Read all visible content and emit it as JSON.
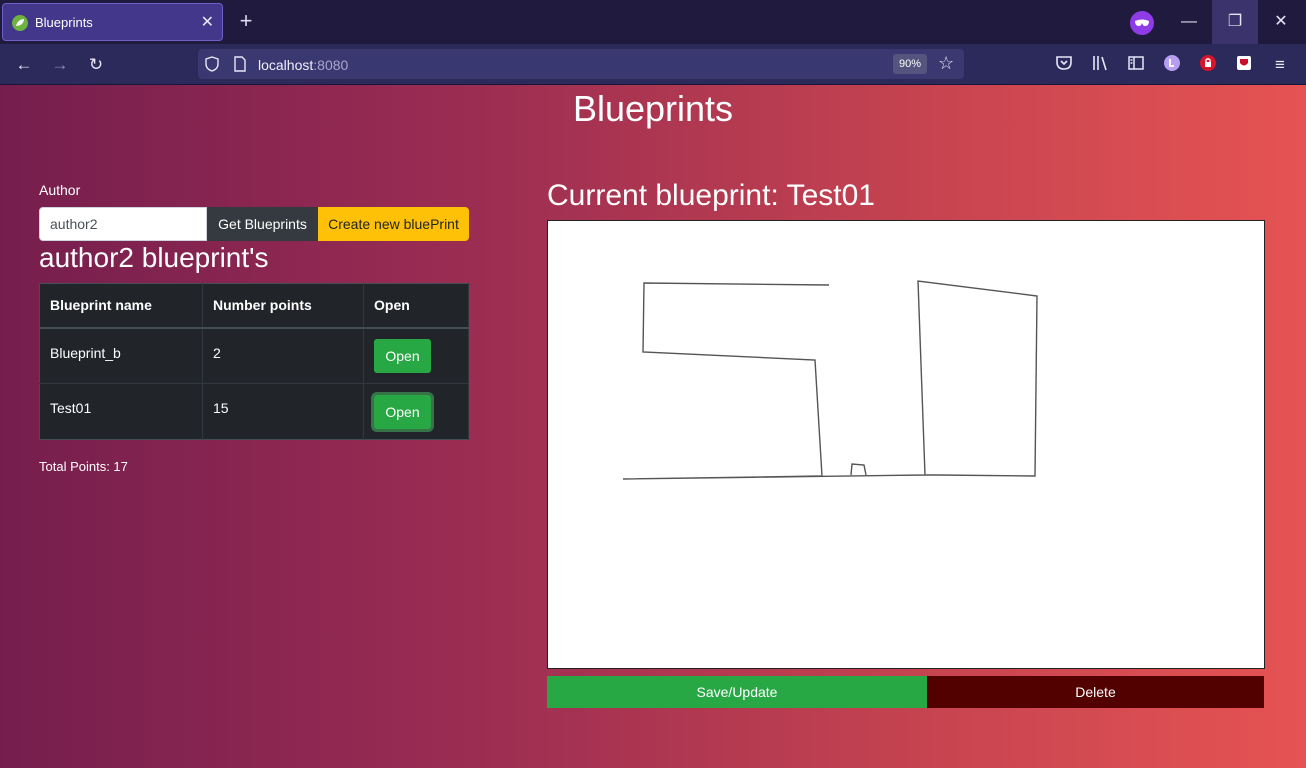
{
  "browser": {
    "tab_title": "Blueprints",
    "url_host": "localhost",
    "url_port": ":8080",
    "zoom": "90%"
  },
  "page": {
    "title": "Blueprints",
    "author_label": "Author",
    "author_value": "author2",
    "get_button": "Get Blueprints",
    "create_button": "Create new bluePrint",
    "list_heading": "author2 blueprint's",
    "table": {
      "headers": [
        "Blueprint name",
        "Number points",
        "Open"
      ],
      "rows": [
        {
          "name": "Blueprint_b",
          "points": "2",
          "action": "Open"
        },
        {
          "name": "Test01",
          "points": "15",
          "action": "Open"
        }
      ]
    },
    "total_points": "Total Points: 17",
    "current_heading": "Current blueprint: Test01",
    "save_button": "Save/Update",
    "delete_button": "Delete",
    "colors": {
      "save": "#28a745",
      "delete": "#520000",
      "create": "#ffc107",
      "table_bg": "#212529"
    }
  }
}
